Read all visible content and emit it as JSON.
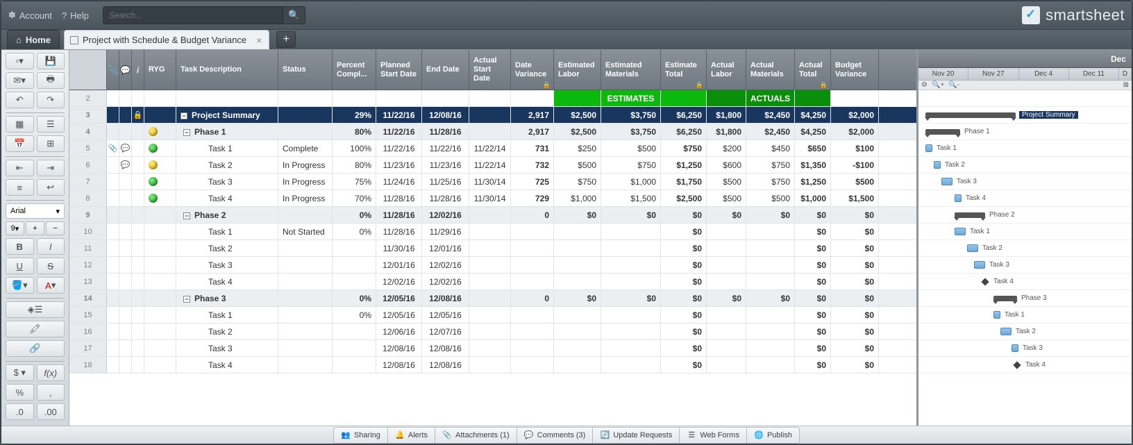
{
  "topbar": {
    "account": "Account",
    "help": "Help",
    "search_placeholder": "Search...",
    "brand": "smartsheet"
  },
  "tabs": {
    "home": "Home",
    "sheet": "Project with Schedule & Budget Variance"
  },
  "toolbar": {
    "font": "Arial",
    "size": "9"
  },
  "columns": {
    "ryg": "RYG",
    "desc": "Task Description",
    "status": "Status",
    "pct": "Percent Compl...",
    "psd": "Planned Start Date",
    "ed": "End Date",
    "asd": "Actual Start Date",
    "dv": "Date Variance",
    "el": "Estimated Labor",
    "em": "Estimated Materials",
    "et": "Estimate Total",
    "al": "Actual Labor",
    "am": "Actual Materials",
    "at": "Actual Total",
    "bv": "Budget Variance"
  },
  "bands": {
    "estimates": "ESTIMATES",
    "actuals": "ACTUALS"
  },
  "rows": [
    {
      "num": "2",
      "type": "band"
    },
    {
      "num": "3",
      "type": "summary",
      "desc": "Project Summary",
      "pct": "29%",
      "psd": "11/22/16",
      "ed": "12/08/16",
      "dv": "2,917",
      "el": "$2,500",
      "em": "$3,750",
      "et": "$6,250",
      "al": "$1,800",
      "am": "$2,450",
      "at": "$4,250",
      "bv": "$2,000",
      "locked": true
    },
    {
      "num": "4",
      "type": "section",
      "ryg": "y",
      "desc": "Phase 1",
      "pct": "80%",
      "psd": "11/22/16",
      "ed": "11/28/16",
      "dv": "2,917",
      "el": "$2,500",
      "em": "$3,750",
      "et": "$6,250",
      "al": "$1,800",
      "am": "$2,450",
      "at": "$4,250",
      "bv": "$2,000"
    },
    {
      "num": "5",
      "type": "task",
      "ryg": "g",
      "attach": true,
      "comment": true,
      "desc": "Task 1",
      "status": "Complete",
      "pct": "100%",
      "psd": "11/22/16",
      "ed": "11/22/16",
      "asd": "11/22/14",
      "dv": "731",
      "el": "$250",
      "em": "$500",
      "et": "$750",
      "al": "$200",
      "am": "$450",
      "at": "$650",
      "bv": "$100"
    },
    {
      "num": "6",
      "type": "task",
      "ryg": "y",
      "comment": true,
      "desc": "Task 2",
      "status": "In Progress",
      "pct": "80%",
      "psd": "11/23/16",
      "ed": "11/23/16",
      "asd": "11/22/14",
      "dv": "732",
      "el": "$500",
      "em": "$750",
      "et": "$1,250",
      "al": "$600",
      "am": "$750",
      "at": "$1,350",
      "bv": "-$100"
    },
    {
      "num": "7",
      "type": "task",
      "ryg": "g",
      "desc": "Task 3",
      "status": "In Progress",
      "pct": "75%",
      "psd": "11/24/16",
      "ed": "11/25/16",
      "asd": "11/30/14",
      "dv": "725",
      "el": "$750",
      "em": "$1,000",
      "et": "$1,750",
      "al": "$500",
      "am": "$750",
      "at": "$1,250",
      "bv": "$500"
    },
    {
      "num": "8",
      "type": "task",
      "ryg": "g",
      "desc": "Task 4",
      "status": "In Progress",
      "pct": "70%",
      "psd": "11/28/16",
      "ed": "11/28/16",
      "asd": "11/30/14",
      "dv": "729",
      "el": "$1,000",
      "em": "$1,500",
      "et": "$2,500",
      "al": "$500",
      "am": "$500",
      "at": "$1,000",
      "bv": "$1,500"
    },
    {
      "num": "9",
      "type": "section",
      "desc": "Phase 2",
      "pct": "0%",
      "psd": "11/28/16",
      "ed": "12/02/16",
      "dv": "0",
      "el": "$0",
      "em": "$0",
      "et": "$0",
      "al": "$0",
      "am": "$0",
      "at": "$0",
      "bv": "$0"
    },
    {
      "num": "10",
      "type": "task",
      "desc": "Task 1",
      "status": "Not Started",
      "pct": "0%",
      "psd": "11/28/16",
      "ed": "11/29/16",
      "et": "$0",
      "at": "$0",
      "bv": "$0"
    },
    {
      "num": "11",
      "type": "task",
      "desc": "Task 2",
      "psd": "11/30/16",
      "ed": "12/01/16",
      "et": "$0",
      "at": "$0",
      "bv": "$0"
    },
    {
      "num": "12",
      "type": "task",
      "desc": "Task 3",
      "psd": "12/01/16",
      "ed": "12/02/16",
      "et": "$0",
      "at": "$0",
      "bv": "$0"
    },
    {
      "num": "13",
      "type": "task",
      "desc": "Task 4",
      "psd": "12/02/16",
      "ed": "12/02/16",
      "et": "$0",
      "at": "$0",
      "bv": "$0"
    },
    {
      "num": "14",
      "type": "section",
      "desc": "Phase 3",
      "pct": "0%",
      "psd": "12/05/16",
      "ed": "12/08/16",
      "dv": "0",
      "el": "$0",
      "em": "$0",
      "et": "$0",
      "al": "$0",
      "am": "$0",
      "at": "$0",
      "bv": "$0"
    },
    {
      "num": "15",
      "type": "task",
      "desc": "Task 1",
      "pct": "0%",
      "psd": "12/05/16",
      "ed": "12/05/16",
      "et": "$0",
      "at": "$0",
      "bv": "$0"
    },
    {
      "num": "16",
      "type": "task",
      "desc": "Task 2",
      "psd": "12/06/16",
      "ed": "12/07/16",
      "et": "$0",
      "at": "$0",
      "bv": "$0"
    },
    {
      "num": "17",
      "type": "task",
      "desc": "Task 3",
      "psd": "12/08/16",
      "ed": "12/08/16",
      "et": "$0",
      "at": "$0",
      "bv": "$0"
    },
    {
      "num": "18",
      "type": "task",
      "desc": "Task 4",
      "psd": "12/08/16",
      "ed": "12/08/16",
      "et": "$0",
      "at": "$0",
      "bv": "$0"
    }
  ],
  "gantt": {
    "month": "Dec",
    "weeks": [
      "Nov 20",
      "Nov 27",
      "Dec 4",
      "Dec 11",
      "D"
    ],
    "labels": {
      "summary": "Project Summary",
      "phase1": "Phase 1",
      "p1t1": "Task 1",
      "p1t2": "Task 2",
      "p1t3": "Task 3",
      "p1t4": "Task 4",
      "phase2": "Phase 2",
      "p2t1": "Task 1",
      "p2t2": "Task 2",
      "p2t3": "Task 3",
      "p2t4": "Task 4",
      "phase3": "Phase 3",
      "p3t1": "Task 1",
      "p3t2": "Task 2",
      "p3t3": "Task 3",
      "p3t4": "Task 4"
    }
  },
  "bottom": {
    "sharing": "Sharing",
    "alerts": "Alerts",
    "attachments": "Attachments  (1)",
    "comments": "Comments  (3)",
    "updates": "Update Requests",
    "webforms": "Web Forms",
    "publish": "Publish"
  }
}
